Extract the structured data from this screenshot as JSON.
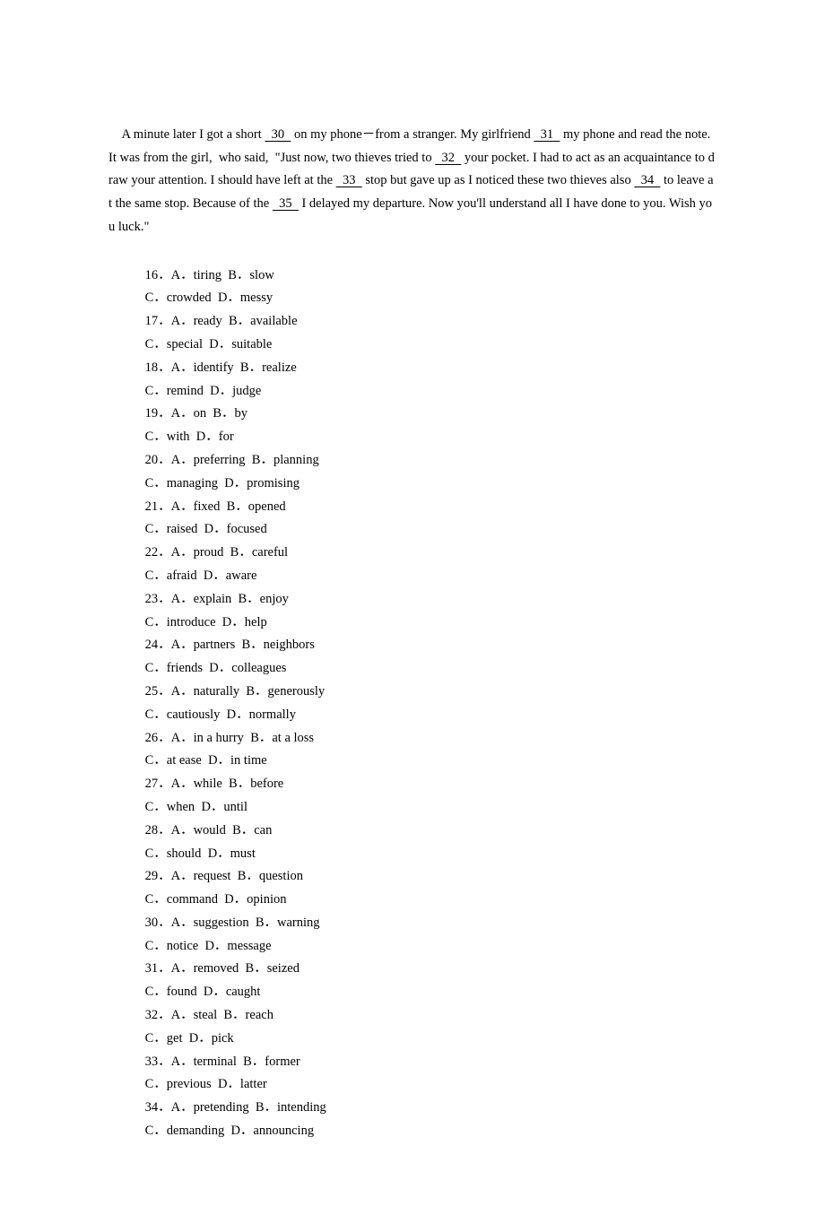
{
  "passage": {
    "line1_pre": "A minute later I got a short ",
    "b30": "  30  ",
    "line1_mid": " on my phone－from a stranger. My girlfriend ",
    "b31": "  31  ",
    "line2_mid": " my phone and read the note. It was from the girl,  who said,  \"Just now, two thieves tried to ",
    "b32": "  32  ",
    "line3_mid": " your pocket. I had to act as an acquaintance to draw your attention. I should have left at the ",
    "b33": "  33  ",
    "line4_mid": " stop but gave up as I noticed these two thieves also ",
    "b34": "  34  ",
    "line5_mid": " to leave at the same stop. Because of the ",
    "b35": "  35  ",
    "line6_end": " I delayed my departure. Now you'll understand all I have done to you. Wish you luck.\""
  },
  "questions": [
    {
      "num": "16．",
      "a": "A．tiring",
      "b": "B．slow",
      "c": "C．crowded",
      "d": "D．messy"
    },
    {
      "num": "17．",
      "a": "A．ready",
      "b": "B．available",
      "c": "C．special",
      "d": "D．suitable"
    },
    {
      "num": "18．",
      "a": "A．identify",
      "b": "B．realize",
      "c": "C．remind",
      "d": "D．judge"
    },
    {
      "num": "19．",
      "a": "A．on",
      "b": "B．by",
      "c": "C．with",
      "d": "D．for"
    },
    {
      "num": "20．",
      "a": "A．preferring",
      "b": "B．planning",
      "c": "C．managing",
      "d": "D．promising"
    },
    {
      "num": "21．",
      "a": "A．fixed",
      "b": "B．opened",
      "c": "C．raised",
      "d": "D．focused"
    },
    {
      "num": "22．",
      "a": "A．proud",
      "b": "B．careful",
      "c": "C．afraid",
      "d": "D．aware"
    },
    {
      "num": "23．",
      "a": "A．explain",
      "b": "B．enjoy",
      "c": "C．introduce",
      "d": "D．help"
    },
    {
      "num": "24．",
      "a": "A．partners",
      "b": "B．neighbors",
      "c": "C．friends",
      "d": "D．colleagues"
    },
    {
      "num": "25．",
      "a": "A．naturally",
      "b": "B．generously",
      "c": "C．cautiously",
      "d": "D．normally"
    },
    {
      "num": "26．",
      "a": "A．in a hurry",
      "b": "B．at a loss",
      "c": "C．at ease",
      "d": "D．in time"
    },
    {
      "num": "27．",
      "a": "A．while",
      "b": "B．before",
      "c": "C．when",
      "d": "D．until"
    },
    {
      "num": "28．",
      "a": "A．would",
      "b": "B．can",
      "c": "C．should",
      "d": "D．must"
    },
    {
      "num": "29．",
      "a": "A．request",
      "b": "B．question",
      "c": "C．command",
      "d": "D．opinion"
    },
    {
      "num": "30．",
      "a": "A．suggestion",
      "b": "B．warning",
      "c": "C．notice",
      "d": "D．message"
    },
    {
      "num": "31．",
      "a": "A．removed",
      "b": "B．seized",
      "c": "C．found",
      "d": "D．caught"
    },
    {
      "num": "32．",
      "a": "A．steal",
      "b": "B．reach",
      "c": "C．get",
      "d": "D．pick"
    },
    {
      "num": "33．",
      "a": "A．terminal",
      "b": "B．former",
      "c": "C．previous",
      "d": "D．latter"
    },
    {
      "num": "34．",
      "a": "A．pretending",
      "b": "B．intending",
      "c": "C．demanding",
      "d": "D．announcing"
    }
  ]
}
